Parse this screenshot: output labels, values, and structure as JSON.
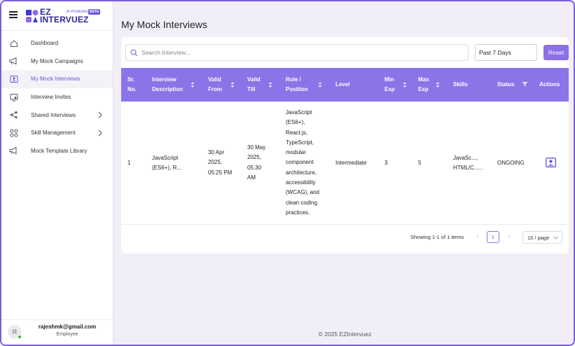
{
  "app": {
    "logo_line1": "EZ",
    "logo_line2": "INTERVUEZ",
    "logo_tag": "AI POWERED",
    "logo_beta": "BETA"
  },
  "sidebar": {
    "items": [
      {
        "label": "Dashboard",
        "icon": "home-icon"
      },
      {
        "label": "My Mock Campaigns",
        "icon": "megaphone-icon"
      },
      {
        "label": "My Mock Interviews",
        "icon": "user-card-icon",
        "active": true
      },
      {
        "label": "Interview Invites",
        "icon": "monitor-user-icon"
      },
      {
        "label": "Shared Interviews",
        "icon": "share-icon",
        "expandable": true
      },
      {
        "label": "Skill Management",
        "icon": "skills-icon",
        "expandable": true
      },
      {
        "label": "Mock Template Library",
        "icon": "megaphone-icon"
      }
    ]
  },
  "user": {
    "initial": "R",
    "email": "rajeshmk@gmail.com",
    "role": "Employee"
  },
  "page": {
    "title": "My Mock Interviews"
  },
  "filters": {
    "search_placeholder": "Search Interview...",
    "period": "Past 7 Days",
    "reset_label": "Reset"
  },
  "table": {
    "headers": {
      "sr_no": [
        "Sr.",
        "No."
      ],
      "description": [
        "Interview",
        "Description"
      ],
      "valid_from": [
        "Valid",
        "From"
      ],
      "valid_till": [
        "Valid",
        "Till"
      ],
      "role": [
        "Role /",
        "Position"
      ],
      "level": [
        "Level"
      ],
      "min_exp": [
        "Min",
        "Exp"
      ],
      "max_exp": [
        "Max",
        "Exp"
      ],
      "skills": [
        "Skills"
      ],
      "status": [
        "Status"
      ],
      "actions": [
        "Actions"
      ]
    },
    "rows": [
      {
        "sr_no": "1",
        "description": [
          "JavaScript",
          "(ES6+), R..."
        ],
        "valid_from": [
          "30 Apr",
          "2025,",
          "05:25 PM"
        ],
        "valid_till": [
          "30 May",
          "2025,",
          "05:30",
          "AM"
        ],
        "role": [
          "JavaScript",
          "(ES6+),",
          "React.js,",
          "TypeScript,",
          "modular",
          "component",
          "architecture,",
          "accessibility",
          "(WCAG), and",
          "clean coding",
          "practices."
        ],
        "level": "Intermediate",
        "min_exp": "3",
        "max_exp": "5",
        "skills": [
          "JavaSc...,",
          "HTML/C......"
        ],
        "status": "ONGOING"
      }
    ]
  },
  "pagination": {
    "summary": "Showing 1-1 of 1 items",
    "current_page": "1",
    "page_size": "10 / page"
  },
  "footer": {
    "text": "© 2025 EZIntervuez"
  },
  "colors": {
    "accent": "#8b74e8",
    "frame": "#7b5ce0",
    "background": "#f1eef7"
  }
}
